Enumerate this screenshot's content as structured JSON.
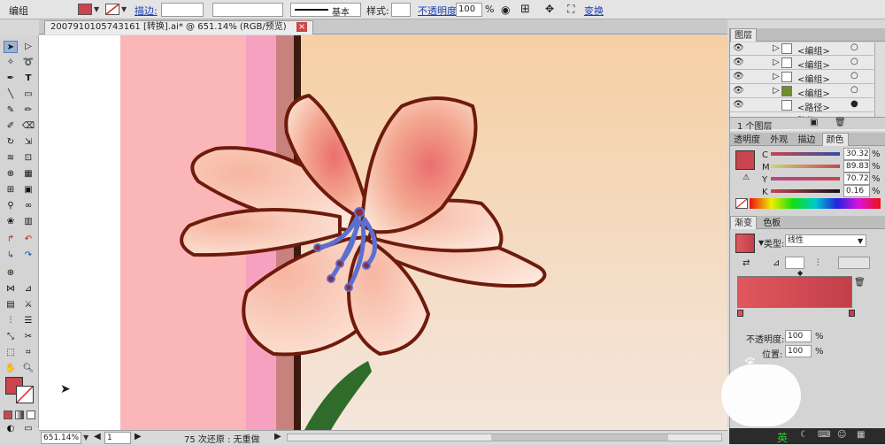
{
  "control_bar": {
    "group_label": "编组",
    "stroke_label": "描边:",
    "stroke_style": "基本",
    "style_label": "样式:",
    "opacity_label": "不透明度:",
    "opacity_value": "100",
    "opacity_unit": "%",
    "transform_label": "变换",
    "fill_color": "#c9454f"
  },
  "document": {
    "tab_title": "2007910105743161 [转换].ai* @ 651.14% (RGB/预览)",
    "close_glyph": "×"
  },
  "status_bar": {
    "zoom": "651.14%",
    "page": "1",
    "undo_text": "75 次还原 : 无重做"
  },
  "layers_panel": {
    "title": "图层",
    "rows": [
      {
        "label": "<编组>"
      },
      {
        "label": "<编组>"
      },
      {
        "label": "<编组>"
      },
      {
        "label": "<编组>"
      },
      {
        "label": "<路径>"
      },
      {
        "label": "路径"
      }
    ],
    "footer": "1 个图层"
  },
  "color_panel": {
    "tabs": [
      "透明度",
      "外观",
      "描边",
      "颜色"
    ],
    "channels": [
      {
        "name": "C",
        "value": "30.32",
        "unit": "%"
      },
      {
        "name": "M",
        "value": "89.83",
        "unit": "%"
      },
      {
        "name": "Y",
        "value": "70.72",
        "unit": "%"
      },
      {
        "name": "K",
        "value": "0.16",
        "unit": "%"
      }
    ],
    "swatch_color": "#c9454f"
  },
  "gradient_panel": {
    "tabs": [
      "渐变",
      "色板"
    ],
    "type_label": "类型:",
    "type_value": "线性",
    "opacity_label": "不透明度:",
    "opacity_value": "100",
    "position_label": "位置:",
    "position_value": "100",
    "unit": "%",
    "gradient_start": "#e0585f",
    "gradient_end": "#c23f48"
  },
  "taskbar": {
    "ime_label": "英"
  }
}
